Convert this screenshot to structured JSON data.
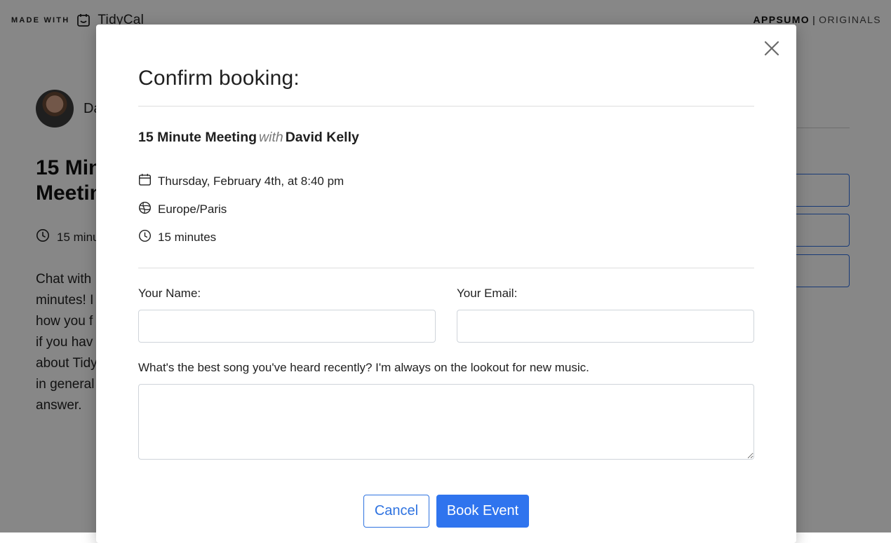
{
  "topbar": {
    "made_with": "MADE WITH",
    "brand": "TidyCal",
    "appsumo": "APPSUMO",
    "separator": "|",
    "originals": "ORIGINALS"
  },
  "background": {
    "host_name": "Da",
    "title": "15 Min\nMeetin",
    "duration": "15 minu",
    "description": "Chat with\nminutes! I\nhow you f\nif you hav\nabout Tidy\nin general\nanswer."
  },
  "modal": {
    "title": "Confirm booking:",
    "event_name": "15 Minute Meeting",
    "with_word": "with",
    "host": "David Kelly",
    "date": "Thursday, February 4th, at 8:40 pm",
    "timezone": "Europe/Paris",
    "duration": "15 minutes",
    "name_label": "Your Name:",
    "name_value": "",
    "email_label": "Your Email:",
    "email_value": "",
    "question_label": "What's the best song you've heard recently? I'm always on the lookout for new music.",
    "question_value": "",
    "cancel_label": "Cancel",
    "book_label": "Book Event"
  },
  "icons": {
    "close": "close-icon",
    "calendar": "calendar-icon",
    "globe": "globe-icon",
    "clock": "clock-icon",
    "tidycal": "tidycal-logo-icon"
  },
  "colors": {
    "primary": "#2f74ee",
    "overlay": "rgba(0,0,0,0.47)"
  }
}
